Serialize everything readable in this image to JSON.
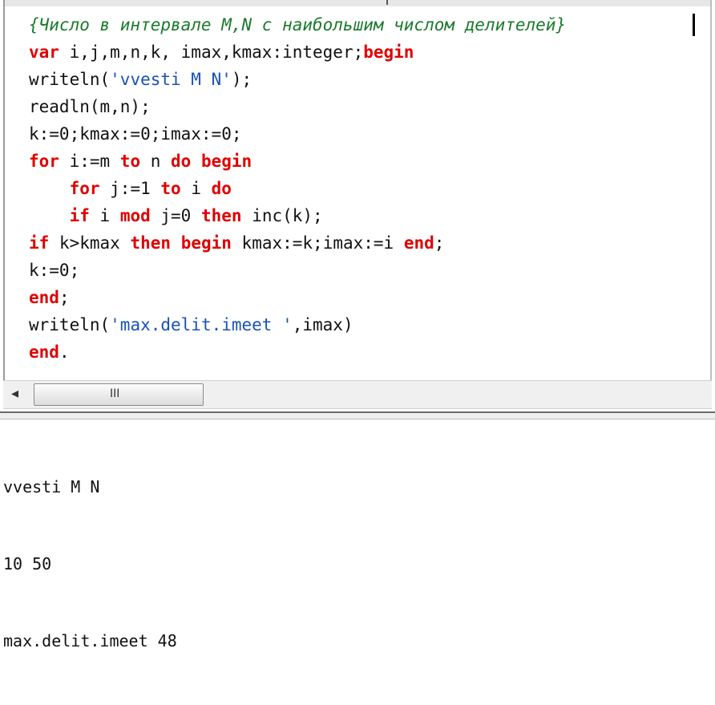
{
  "editor": {
    "lines": [
      [
        {
          "t": "{Число в интервале M,N с наибольшим числом делителей}",
          "c": "cmt"
        }
      ],
      [
        {
          "t": "var",
          "c": "kw"
        },
        {
          "t": " i,j,m,n,k, imax,kmax:integer;",
          "c": ""
        },
        {
          "t": "begin",
          "c": "kw"
        }
      ],
      [
        {
          "t": "writeln(",
          "c": ""
        },
        {
          "t": "'vvesti M N'",
          "c": "str"
        },
        {
          "t": ");",
          "c": ""
        }
      ],
      [
        {
          "t": "readln(m,n);",
          "c": ""
        }
      ],
      [
        {
          "t": "k:=0;kmax:=0;imax:=0;",
          "c": ""
        }
      ],
      [
        {
          "t": "for",
          "c": "kw"
        },
        {
          "t": " i:=m ",
          "c": ""
        },
        {
          "t": "to",
          "c": "kw"
        },
        {
          "t": " n ",
          "c": ""
        },
        {
          "t": "do",
          "c": "kw"
        },
        {
          "t": " ",
          "c": ""
        },
        {
          "t": "begin",
          "c": "kw"
        }
      ],
      [
        {
          "t": "    ",
          "c": ""
        },
        {
          "t": "for",
          "c": "kw"
        },
        {
          "t": " j:=1 ",
          "c": ""
        },
        {
          "t": "to",
          "c": "kw"
        },
        {
          "t": " i ",
          "c": ""
        },
        {
          "t": "do",
          "c": "kw"
        }
      ],
      [
        {
          "t": "    ",
          "c": ""
        },
        {
          "t": "if",
          "c": "kw"
        },
        {
          "t": " i ",
          "c": ""
        },
        {
          "t": "mod",
          "c": "kw"
        },
        {
          "t": " j=0 ",
          "c": ""
        },
        {
          "t": "then",
          "c": "kw"
        },
        {
          "t": " inc(k);",
          "c": ""
        }
      ],
      [
        {
          "t": "if",
          "c": "kw"
        },
        {
          "t": " k>kmax ",
          "c": ""
        },
        {
          "t": "then",
          "c": "kw"
        },
        {
          "t": " ",
          "c": ""
        },
        {
          "t": "begin",
          "c": "kw"
        },
        {
          "t": " kmax:=k;imax:=i ",
          "c": ""
        },
        {
          "t": "end",
          "c": "kw"
        },
        {
          "t": ";",
          "c": ""
        }
      ],
      [
        {
          "t": "k:=0;",
          "c": ""
        }
      ],
      [
        {
          "t": "end",
          "c": "kw"
        },
        {
          "t": ";",
          "c": ""
        }
      ],
      [
        {
          "t": "writeln(",
          "c": ""
        },
        {
          "t": "'max.delit.imeet '",
          "c": "str"
        },
        {
          "t": ",imax)",
          "c": ""
        }
      ],
      [
        {
          "t": "end",
          "c": "kw"
        },
        {
          "t": ".",
          "c": ""
        }
      ]
    ]
  },
  "scrollbar": {
    "left_arrow": "◂",
    "grip": "III"
  },
  "output": {
    "lines": [
      "vvesti M N",
      "10 50",
      "max.delit.imeet 48"
    ]
  }
}
